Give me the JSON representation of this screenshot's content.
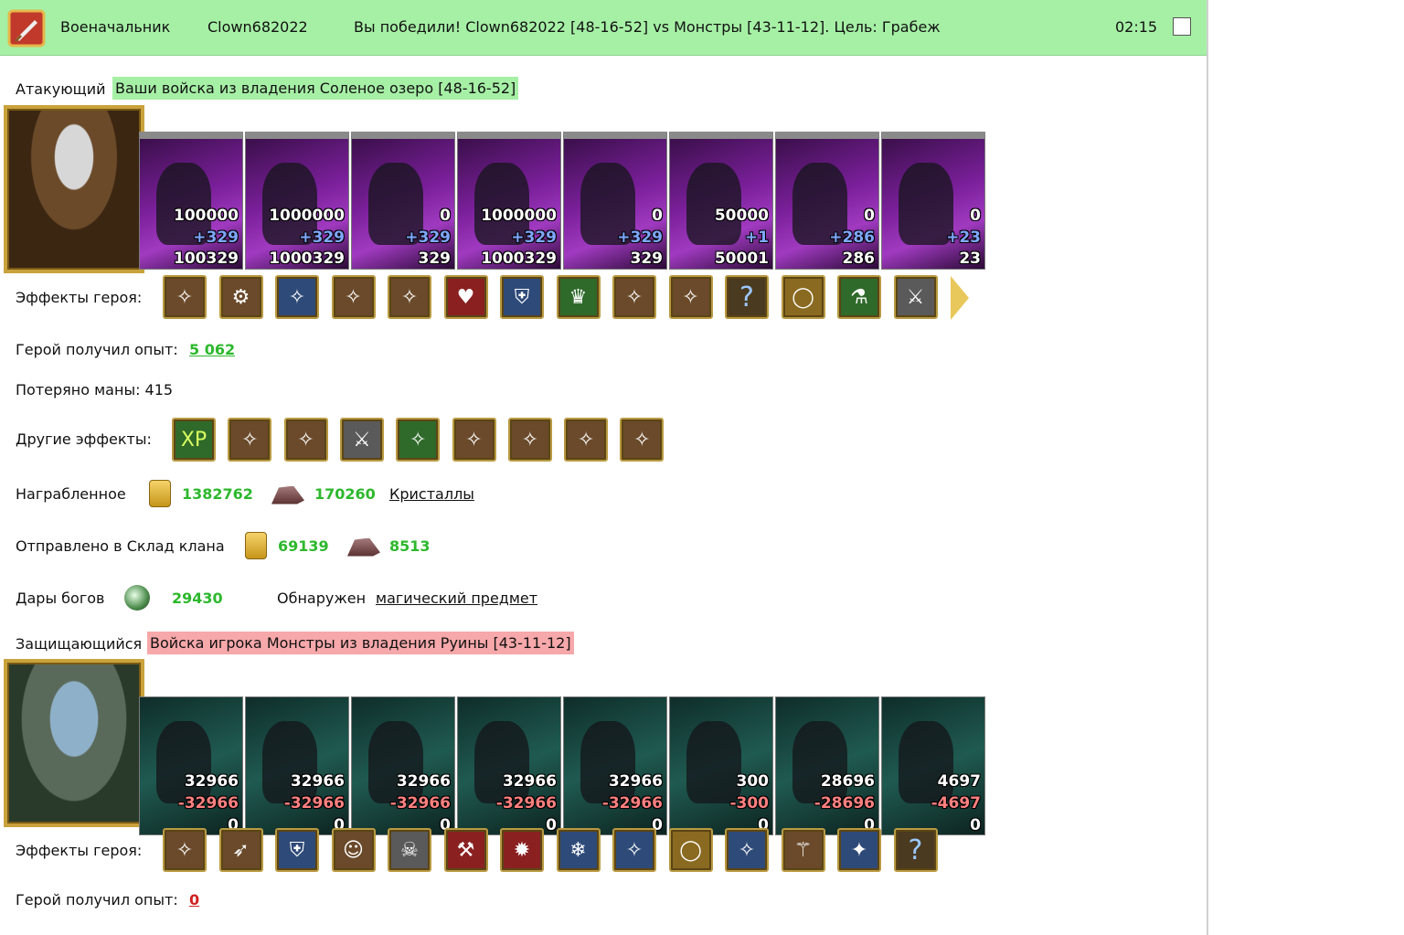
{
  "header": {
    "rank": "Военачальник",
    "player": "Clown682022",
    "result": "Вы победили! Clown682022 [48-16-52] vs Монстры [43-11-12]. Цель: Грабеж",
    "timer": "02:15"
  },
  "attacker": {
    "label": "Атакующий",
    "tag": "Ваши войска из владения Соленое озеро [48-16-52]",
    "units": [
      {
        "a": "100000",
        "b": "+329",
        "c": "100329"
      },
      {
        "a": "1000000",
        "b": "+329",
        "c": "1000329"
      },
      {
        "a": "0",
        "b": "+329",
        "c": "329"
      },
      {
        "a": "1000000",
        "b": "+329",
        "c": "1000329"
      },
      {
        "a": "0",
        "b": "+329",
        "c": "329"
      },
      {
        "a": "50000",
        "b": "+1",
        "c": "50001"
      },
      {
        "a": "0",
        "b": "+286",
        "c": "286"
      },
      {
        "a": "0",
        "b": "+23",
        "c": "23"
      }
    ],
    "effects_label": "Эффекты героя:",
    "effects": [
      "cart-icon",
      "cog-icon",
      "orb-icon",
      "chest-icon",
      "flame-chest-icon",
      "heart-icon",
      "shield-icon",
      "crown-icon",
      "armor-icon",
      "amulet-icon",
      "question-icon",
      "ring-icon",
      "flask-icon",
      "sword-icon"
    ],
    "exp_label": "Герой получил опыт:",
    "exp_value": "5 062",
    "mana_text": "Потеряно маны: 415",
    "other_label": "Другие эффекты:",
    "other": [
      "XP",
      "fist-sword-icon",
      "fist-sword-icon",
      "sword-icon",
      "green-sword-icon",
      "scroll-icon",
      "heart-sword-icon",
      "fist-sword-icon",
      "fist-sword-icon"
    ],
    "loot_label": "Награбленное",
    "loot_gold": "1382762",
    "loot_ore": "170260",
    "loot_link": "Кристаллы",
    "clan_label": "Отправлено в Склад клана",
    "clan_gold": "69139",
    "clan_ore": "8513",
    "gods_label": "Дары богов",
    "gods_value": "29430",
    "found_label": "Обнаружен",
    "found_link": "магический предмет"
  },
  "defender": {
    "label": "Защищающийся",
    "tag": "Войска игрока Монстры из владения Руины [43-11-12]",
    "units": [
      {
        "a": "32966",
        "b": "-32966",
        "c": "0"
      },
      {
        "a": "32966",
        "b": "-32966",
        "c": "0"
      },
      {
        "a": "32966",
        "b": "-32966",
        "c": "0"
      },
      {
        "a": "32966",
        "b": "-32966",
        "c": "0"
      },
      {
        "a": "32966",
        "b": "-32966",
        "c": "0"
      },
      {
        "a": "300",
        "b": "-300",
        "c": "0"
      },
      {
        "a": "28696",
        "b": "-28696",
        "c": "0"
      },
      {
        "a": "4697",
        "b": "-4697",
        "c": "0"
      }
    ],
    "effects_label": "Эффекты героя:",
    "effects": [
      "helmet-icon",
      "arrows-icon",
      "shield-icon",
      "face-icon",
      "skull-icon",
      "pickaxe-icon",
      "fire-icon",
      "ice-icon",
      "frost-armor-icon",
      "ring-icon",
      "ice-axe-icon",
      "staff-icon",
      "crystal-icon",
      "question-icon"
    ],
    "exp_label": "Герой получил опыт:",
    "exp_value": "0"
  }
}
